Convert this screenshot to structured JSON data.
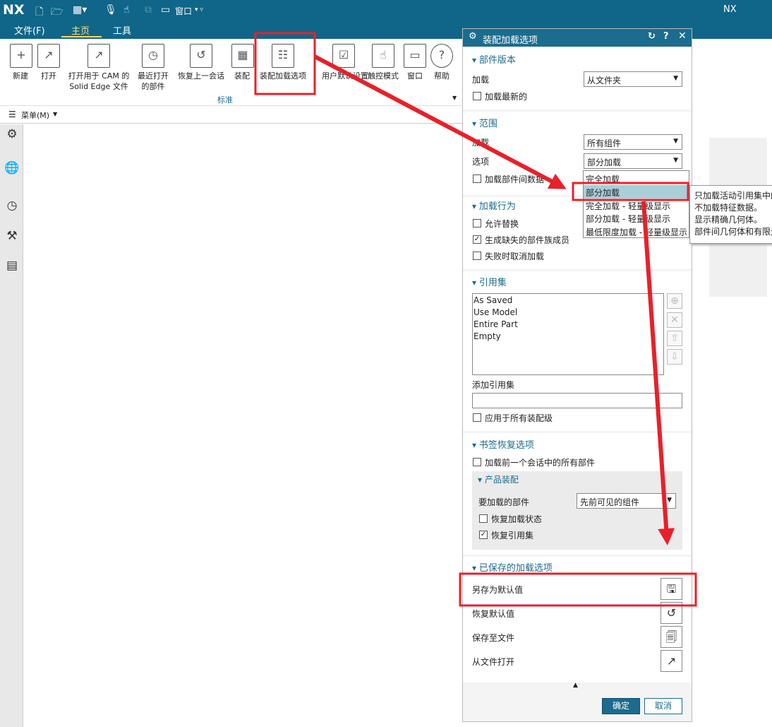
{
  "app": {
    "logo": "NX",
    "title_right": "NX",
    "quick_window": "窗口"
  },
  "tabs": [
    "文件(F)",
    "主页",
    "工具"
  ],
  "ribbon": {
    "items": [
      {
        "label": "新建",
        "icon": "new-file-icon",
        "g": "+"
      },
      {
        "label": "打开",
        "icon": "open-folder-icon",
        "g": "↗"
      },
      {
        "label": "打开用于 CAM 的\nSolid Edge 文件",
        "icon": "open-cam-icon",
        "g": "↗"
      },
      {
        "label": "最近打开\n的部件",
        "icon": "recent-parts-icon",
        "g": "◷"
      },
      {
        "label": "恢复上一会话",
        "icon": "restore-session-icon",
        "g": "↺"
      },
      {
        "label": "装配",
        "icon": "assembly-icon",
        "g": "▦"
      },
      {
        "label": "装配加载选项",
        "icon": "assembly-load-options-icon",
        "g": "☷"
      },
      {
        "label": "用户默认设置",
        "icon": "user-defaults-icon",
        "g": "☑"
      },
      {
        "label": "触控模式",
        "icon": "touch-mode-icon",
        "g": "☝"
      },
      {
        "label": "窗口",
        "icon": "window-icon",
        "g": "▭"
      },
      {
        "label": "帮助",
        "icon": "help-icon",
        "g": "?"
      }
    ],
    "group": "标准"
  },
  "menu": "菜单(M)",
  "dialog": {
    "title": "装配加载选项",
    "part_version": {
      "header": "部件版本",
      "load_label": "加载",
      "load_value": "从文件夹",
      "latest": "加载最新的",
      "latest_checked": false
    },
    "scope": {
      "header": "范围",
      "load_label": "加载",
      "load_value": "所有组件",
      "option_label": "选项",
      "option_value": "部分加载",
      "interpart": "加载部件间数据"
    },
    "dropdown": {
      "options": [
        "完全加载",
        "部分加载",
        "完全加载 - 轻量级显示",
        "部分加载 - 轻量级显示",
        "最低限度加载 - 轻量级显示"
      ],
      "selected": "部分加载"
    },
    "tooltip": [
      "只加载活动引用集中的",
      "不加载特征数据。",
      "显示精确几何体。",
      "部件间几何体和有限元"
    ],
    "behavior": {
      "header": "加载行为",
      "items": [
        {
          "label": "允许替换",
          "checked": false
        },
        {
          "label": "生成缺失的部件族成员",
          "checked": true
        },
        {
          "label": "失败时取消加载",
          "checked": false
        }
      ]
    },
    "refsets": {
      "header": "引用集",
      "items": [
        "As Saved",
        "Use Model",
        "Entire Part",
        "Empty"
      ],
      "add_label": "添加引用集",
      "add_value": "",
      "apply_all": "应用于所有装配级"
    },
    "bookmark": {
      "header": "书签恢复选项",
      "load_prev": "加载前一个会话中的所有部件",
      "sub_header": "产品装配",
      "parts_label": "要加载的部件",
      "parts_value": "先前可见的组件",
      "restore_load": "恢复加载状态",
      "restore_load_checked": false,
      "restore_ref": "恢复引用集",
      "restore_ref_checked": true
    },
    "saved": {
      "header": "已保存的加载选项",
      "rows": [
        {
          "label": "另存为默认值",
          "icon": "save-icon",
          "g": "💾"
        },
        {
          "label": "恢复默认值",
          "icon": "reset-icon",
          "g": "↺"
        },
        {
          "label": "保存至文件",
          "icon": "save-file-icon",
          "g": "🗐"
        },
        {
          "label": "从文件打开",
          "icon": "open-file-icon",
          "g": "↗"
        }
      ]
    },
    "ok": "确定",
    "cancel": "取消"
  },
  "colors": {
    "brand": "#0f6688",
    "annotation": "#e8202a",
    "selected": "#a9cfd9"
  }
}
